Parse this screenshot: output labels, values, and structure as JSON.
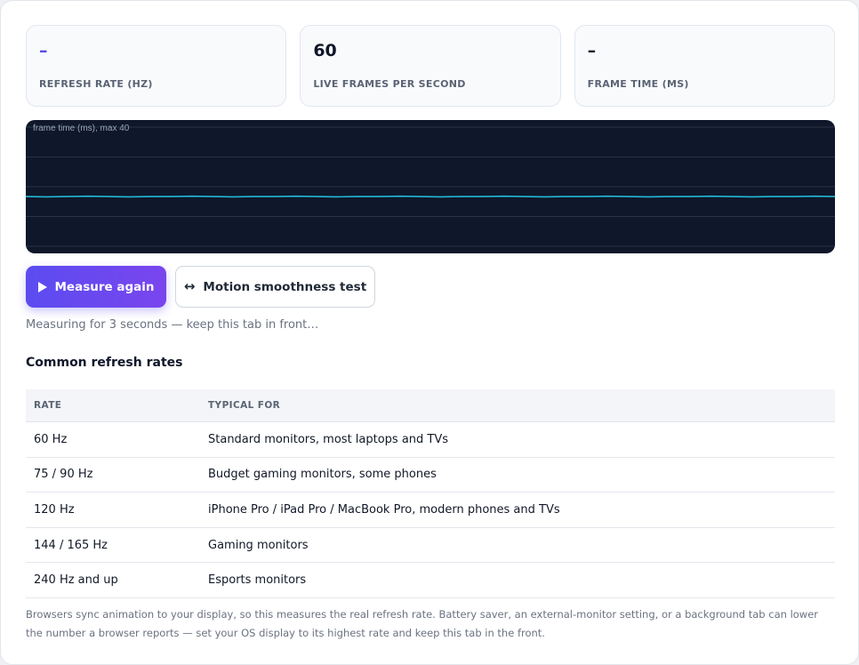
{
  "stats": [
    {
      "value": "–",
      "label": "REFRESH RATE (HZ)"
    },
    {
      "value": "60",
      "label": "LIVE FRAMES PER SECOND"
    },
    {
      "value": "–",
      "label": "FRAME TIME (MS)"
    }
  ],
  "graph": {
    "caption": "frame time (ms), max 40",
    "max_ms": 40,
    "line_color": "#22b8d6",
    "samples_ms": [
      16.7,
      16.6,
      16.7,
      16.8,
      16.7,
      16.6,
      16.7,
      16.7,
      16.8,
      16.7,
      16.6,
      16.7,
      16.7,
      16.8,
      16.7,
      16.6,
      16.7,
      16.7,
      16.8,
      16.7,
      16.6,
      16.7,
      16.7,
      16.8,
      16.7,
      16.6,
      16.7,
      16.7,
      16.8,
      16.7,
      16.6,
      16.7,
      16.7,
      16.8,
      16.7,
      16.6,
      16.7,
      16.7,
      16.8,
      16.7
    ]
  },
  "buttons": {
    "measure_label": "Measure again",
    "motion_label": "Motion smoothness test"
  },
  "status": "Measuring for 3 seconds — keep this tab in front…",
  "section_title": "Common refresh rates",
  "table": {
    "headers": [
      "RATE",
      "TYPICAL FOR"
    ],
    "rows": [
      [
        "60 Hz",
        "Standard monitors, most laptops and TVs"
      ],
      [
        "75 / 90 Hz",
        "Budget gaming monitors, some phones"
      ],
      [
        "120 Hz",
        "iPhone Pro / iPad Pro / MacBook Pro, modern phones and TVs"
      ],
      [
        "144 / 165 Hz",
        "Gaming monitors"
      ],
      [
        "240 Hz and up",
        "Esports monitors"
      ]
    ]
  },
  "footnote": "Browsers sync animation to your display, so this measures the real refresh rate. Battery saver, an external-monitor setting, or a background tab can lower the number a browser reports — set your OS display to its highest rate and keep this tab in the front.",
  "colors": {
    "accent": "#5b4ce6",
    "graph_bg": "#0f172a"
  }
}
